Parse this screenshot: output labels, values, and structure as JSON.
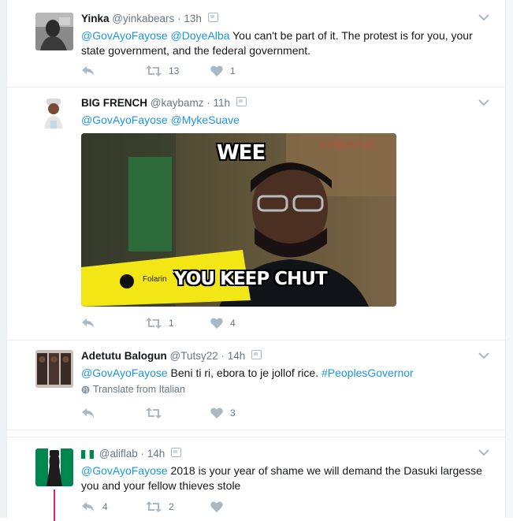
{
  "tweets": [
    {
      "name": "Yinka",
      "handle": "@yinkabears",
      "sep": "·",
      "time": "13h",
      "mentions": [
        "@GovAyoFayose",
        "@DoyeAlba"
      ],
      "text": " You can't be part of it. The protest is for you, your state government, and the federal government.",
      "retweets": "13",
      "likes": "1"
    },
    {
      "name": "BIG FRENCH",
      "handle": "@kaybamz",
      "sep": "·",
      "time": "11h",
      "mentions": [
        "@GovAyoFayose",
        "@MykeSuave"
      ],
      "media": {
        "top_text": "WEE",
        "bottom_text": "YOU KEEP CHUT",
        "watermark": "notjustok",
        "brand": "Folarin"
      },
      "retweets": "1",
      "likes": "4"
    },
    {
      "name": "Adetutu Balogun",
      "handle": "@Tutsy22",
      "sep": "·",
      "time": "14h",
      "mentions": [
        "@GovAyoFayose"
      ],
      "text": " Beni ti ri, ebora to je jollof rice. ",
      "hashtag": "#PeoplesGovernor",
      "translate": "Translate from Italian",
      "retweets": "",
      "likes": "3"
    },
    {
      "name": "",
      "handle": "@aliflab",
      "sep": "·",
      "time": "14h",
      "mentions": [
        "@GovAyoFayose"
      ],
      "text": " 2018 is your year of shame we will demand the Dasuki largesse you and your fellow thieves stole",
      "replies": "4",
      "retweets": "2",
      "likes": ""
    }
  ],
  "colors": {
    "link": "#1b95e0",
    "muted": "#657786",
    "icon": "#aab8c2",
    "thread": "#e0245e",
    "divider": "#e6ecf0"
  },
  "icons": [
    "reply-icon",
    "retweet-icon",
    "like-icon",
    "chevron-down-icon",
    "globe-icon",
    "device-icon"
  ]
}
